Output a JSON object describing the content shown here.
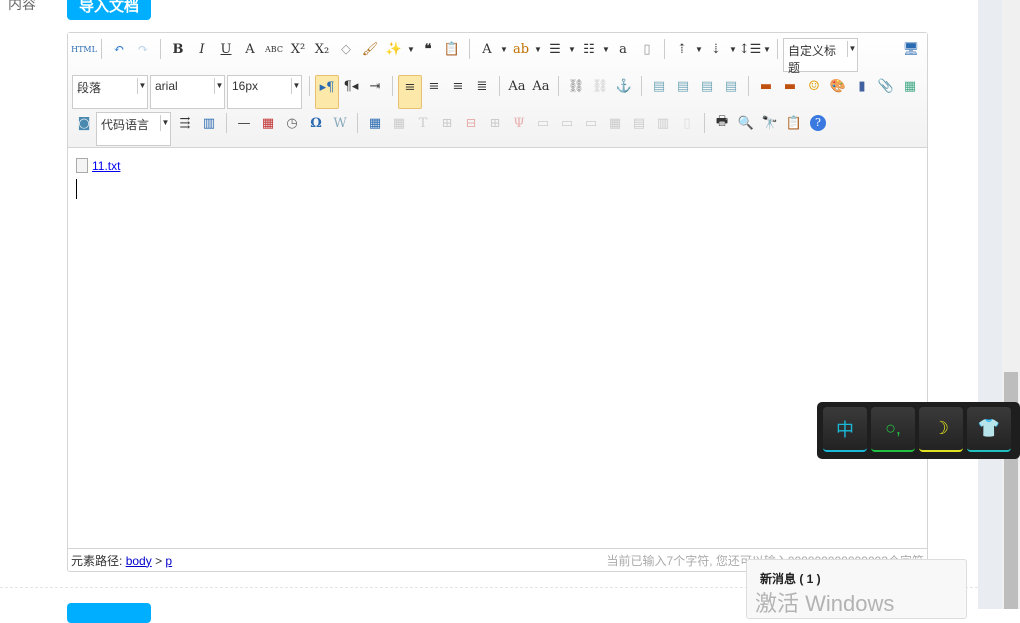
{
  "form": {
    "label": "内容",
    "import_button": "导入文档"
  },
  "toolbar": {
    "rows": [
      [
        {
          "n": "html-icon",
          "g": "HTML",
          "c": "#2a6ab0",
          "s": 8
        },
        "|",
        {
          "n": "undo-icon",
          "g": "↶",
          "c": "#2a7ad0"
        },
        {
          "n": "redo-icon",
          "g": "↷",
          "c": "#b8d0e8"
        },
        "|",
        {
          "n": "bold-icon",
          "g": "B",
          "b": 1
        },
        {
          "n": "italic-icon",
          "g": "I",
          "i": 1
        },
        {
          "n": "underline-icon",
          "g": "U",
          "u": 1
        },
        {
          "n": "fontborder-icon",
          "g": "A"
        },
        {
          "n": "strikethrough-icon",
          "g": "ABC",
          "s": 8
        },
        {
          "n": "superscript-icon",
          "g": "X²"
        },
        {
          "n": "subscript-icon",
          "g": "X₂"
        },
        {
          "n": "eraser-icon",
          "g": "◇",
          "c": "#999"
        },
        {
          "n": "format-brush-icon",
          "g": "🖌",
          "c": "#b07020"
        },
        {
          "n": "magic-icon",
          "g": "✨",
          "c": "#e08020",
          "dd": 1
        },
        {
          "n": "quote-icon",
          "g": "❝",
          "b": 1
        },
        {
          "n": "paste-text-icon",
          "g": "📋"
        },
        "|",
        {
          "n": "font-color-icon",
          "g": "A",
          "dd": 1
        },
        {
          "n": "highlight-icon",
          "g": "ab",
          "c": "#c07000",
          "dd": 1
        },
        {
          "n": "ordered-list-icon",
          "g": "☰",
          "dd": 1
        },
        {
          "n": "unordered-list-icon",
          "g": "☷",
          "dd": 1
        },
        {
          "n": "select-all-icon",
          "g": "a",
          "c": "#333"
        },
        {
          "n": "clear-doc-icon",
          "g": "▯",
          "c": "#999"
        },
        "|",
        {
          "n": "row-spacing-top-icon",
          "g": "⇡",
          "dd": 1
        },
        {
          "n": "row-spacing-bottom-icon",
          "g": "⇣",
          "dd": 1
        },
        {
          "n": "line-height-icon",
          "g": "↕☰",
          "dd": 1
        },
        "|",
        {
          "sel": "custom_heading"
        },
        {
          "sp": 1
        },
        {
          "n": "preview-icon",
          "g": "🖥",
          "c": "#2a6ab0"
        }
      ],
      [
        {
          "sel": "paragraph"
        },
        {
          "sel": "font_family"
        },
        {
          "sel": "font_size"
        },
        "|",
        {
          "n": "ltr-icon",
          "g": "▸¶",
          "c": "#2a6ab0",
          "on": 1
        },
        {
          "n": "rtl-icon",
          "g": "¶◂"
        },
        {
          "n": "indent-icon",
          "g": "⇥"
        },
        "|",
        {
          "n": "align-left-icon",
          "g": "≡",
          "on": 1
        },
        {
          "n": "align-center-icon",
          "g": "≡"
        },
        {
          "n": "align-right-icon",
          "g": "≡"
        },
        {
          "n": "justify-icon",
          "g": "≣"
        },
        "|",
        {
          "n": "to-uppercase-icon",
          "g": "Aa"
        },
        {
          "n": "to-lowercase-icon",
          "g": "Aa"
        },
        "|",
        {
          "n": "link-icon",
          "g": "⛓",
          "c": "#888"
        },
        {
          "n": "unlink-icon",
          "g": "⛓",
          "c": "#ccc"
        },
        {
          "n": "anchor-icon",
          "g": "⚓",
          "c": "#2a7ad0"
        },
        "|",
        {
          "n": "image-none-icon",
          "g": "▤",
          "c": "#7ab"
        },
        {
          "n": "image-left-icon",
          "g": "▤",
          "c": "#7ab"
        },
        {
          "n": "image-right-icon",
          "g": "▤",
          "c": "#7ab"
        },
        {
          "n": "image-center-icon",
          "g": "▤",
          "c": "#7ab"
        },
        "|",
        {
          "n": "image-icon",
          "g": "▬",
          "c": "#c05010"
        },
        {
          "n": "multi-image-icon",
          "g": "▬",
          "c": "#c05010"
        },
        {
          "n": "emotion-icon",
          "g": "☺",
          "c": "#e0a000"
        },
        {
          "n": "scrawl-icon",
          "g": "🎨"
        },
        {
          "n": "video-icon",
          "g": "▮",
          "c": "#4060a0"
        },
        {
          "n": "attachment-icon",
          "g": "📎",
          "c": "#2a6ab0"
        },
        {
          "n": "map-icon",
          "g": "▦",
          "c": "#4a8"
        }
      ],
      [
        {
          "n": "insert-frame-icon",
          "g": "◙",
          "c": "#4a8ab0"
        },
        {
          "sel": "code_language"
        },
        {
          "n": "page-break-icon",
          "g": "⇶",
          "c": "#333"
        },
        {
          "n": "template-icon",
          "g": "▥",
          "c": "#2a6ab0"
        },
        "|",
        {
          "n": "horizontal-rule-icon",
          "g": "—"
        },
        {
          "n": "date-icon",
          "g": "▦",
          "c": "#c03030"
        },
        {
          "n": "time-icon",
          "g": "◷",
          "c": "#666"
        },
        {
          "n": "special-char-icon",
          "g": "Ω",
          "c": "#2a6ab0",
          "b": 1
        },
        {
          "n": "word-image-icon",
          "g": "W",
          "c": "#8ab"
        },
        "|",
        {
          "n": "insert-table-icon",
          "g": "▦",
          "c": "#2a6ab0"
        },
        {
          "n": "delete-table-icon",
          "g": "▦",
          "c": "#ccc"
        },
        {
          "n": "insert-caption-icon",
          "g": "T",
          "c": "#ccc"
        },
        {
          "n": "insert-row-icon",
          "g": "⊞",
          "c": "#ccc"
        },
        {
          "n": "delete-row-icon",
          "g": "⊟",
          "c": "#e8b0b0"
        },
        {
          "n": "insert-col-icon",
          "g": "⊞",
          "c": "#ccc"
        },
        {
          "n": "delete-col-icon",
          "g": "Ψ",
          "c": "#e8b0b0"
        },
        {
          "n": "merge-cells-icon",
          "g": "▭",
          "c": "#ccc"
        },
        {
          "n": "merge-right-icon",
          "g": "▭",
          "c": "#ccc"
        },
        {
          "n": "merge-down-icon",
          "g": "▭",
          "c": "#ccc"
        },
        {
          "n": "split-cells-icon",
          "g": "▦",
          "c": "#ccc"
        },
        {
          "n": "split-rows-icon",
          "g": "▤",
          "c": "#ccc"
        },
        {
          "n": "split-cols-icon",
          "g": "▥",
          "c": "#ccc"
        },
        {
          "n": "charts-icon",
          "g": "▯",
          "c": "#ddd"
        },
        "|",
        {
          "n": "print-icon",
          "g": "🖶",
          "c": "#333"
        },
        {
          "n": "search-preview-icon",
          "g": "🔍"
        },
        {
          "n": "search-replace-icon",
          "g": "🔭",
          "c": "#333"
        },
        {
          "n": "auto-typeset-icon",
          "g": "📋"
        },
        {
          "n": "help-icon",
          "g": "?",
          "c": "#fff",
          "bg": "#3a7ae0"
        }
      ]
    ],
    "selects": {
      "custom_heading": "自定义标题",
      "paragraph": "段落",
      "font_family": "arial",
      "font_size": "16px",
      "code_language": "代码语言"
    }
  },
  "content": {
    "file_name": "11.txt"
  },
  "status": {
    "path_label": "元素路径:",
    "path_body": "body",
    "path_sep": ">",
    "path_p": "p",
    "count_text": "当前已输入7个字符, 您还可以输入999999999999993个字符"
  },
  "ime": {
    "keys": [
      {
        "n": "ime-chinese-key",
        "g": "中",
        "c": "#19b8d8"
      },
      {
        "n": "ime-punctuation-key",
        "g": "○,",
        "c": "#20c040"
      },
      {
        "n": "ime-moon-key",
        "g": "☽",
        "c": "#e0e020"
      },
      {
        "n": "ime-skin-key",
        "g": "👕",
        "c": "#20c0c0"
      }
    ]
  },
  "notification": {
    "title": "新消息 ( 1 )"
  },
  "watermark": "激活 Windows"
}
